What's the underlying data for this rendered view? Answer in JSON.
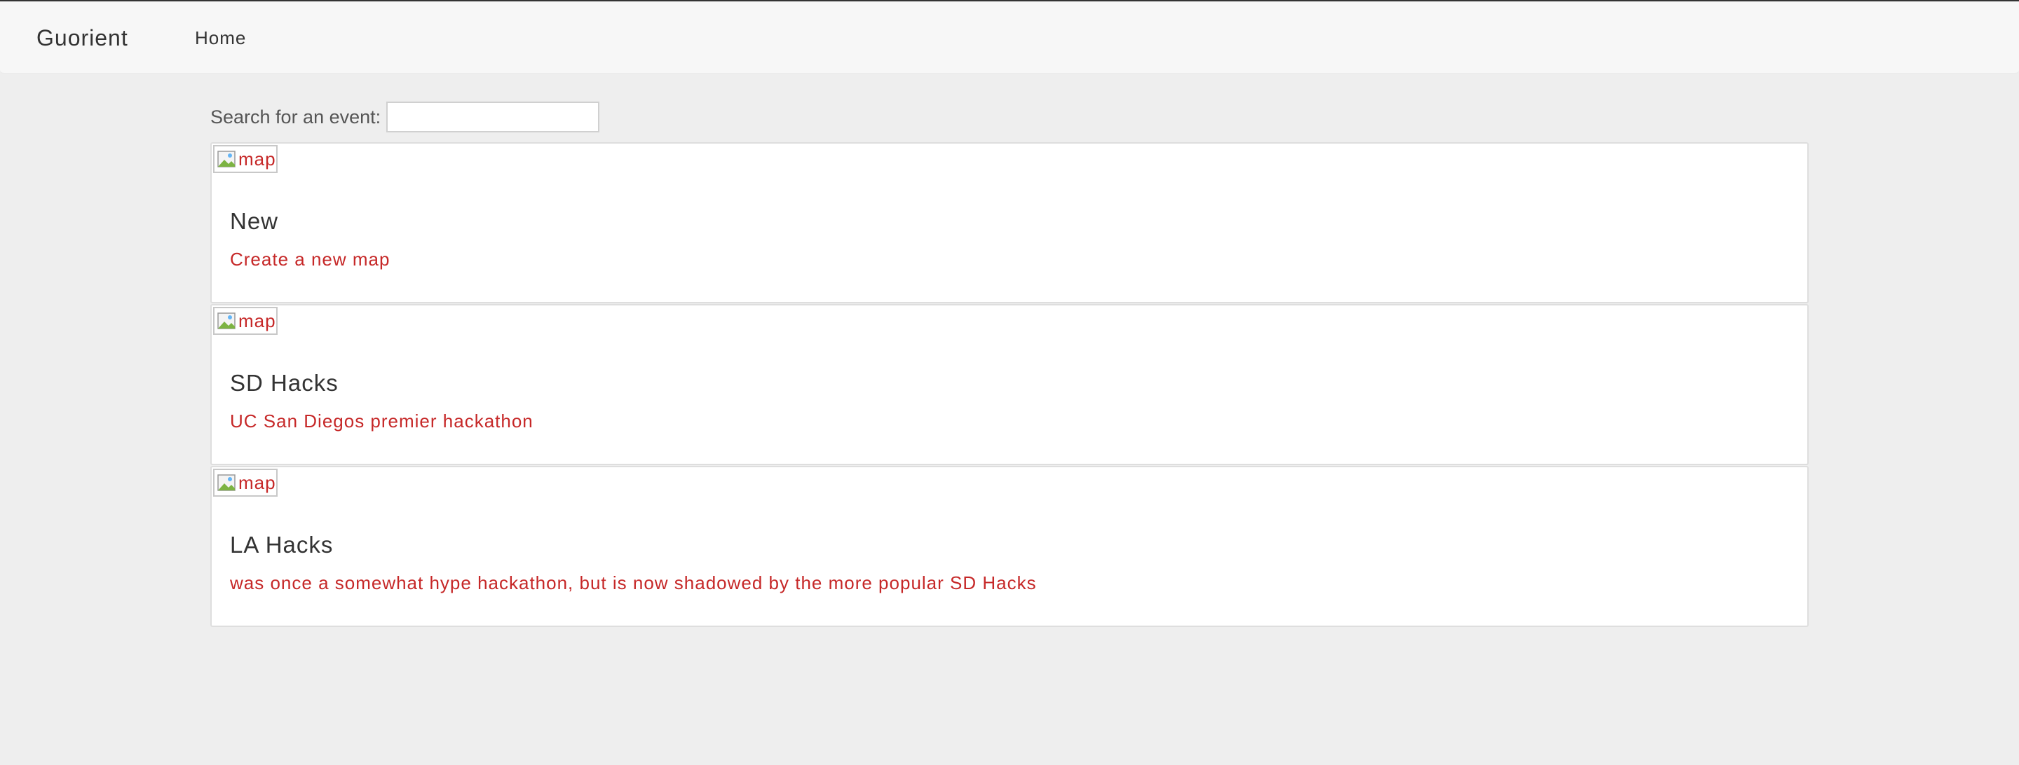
{
  "navbar": {
    "brand": "Guorient",
    "links": [
      {
        "label": "Home"
      }
    ]
  },
  "search": {
    "label": "Search for an event:",
    "value": "",
    "placeholder": ""
  },
  "events": [
    {
      "image_alt": "map",
      "title": "New",
      "description": "Create a new map"
    },
    {
      "image_alt": "map",
      "title": "SD Hacks",
      "description": "UC San Diegos premier hackathon"
    },
    {
      "image_alt": "map",
      "title": "LA Hacks",
      "description": "was once a somewhat hype hackathon, but is now shadowed by the more popular SD Hacks"
    }
  ],
  "colors": {
    "page_background": "#eeeeee",
    "navbar_background": "#f7f7f7",
    "card_background": "#ffffff",
    "accent_text": "#c62828"
  },
  "icons": {
    "card_image": "broken-image-icon"
  }
}
